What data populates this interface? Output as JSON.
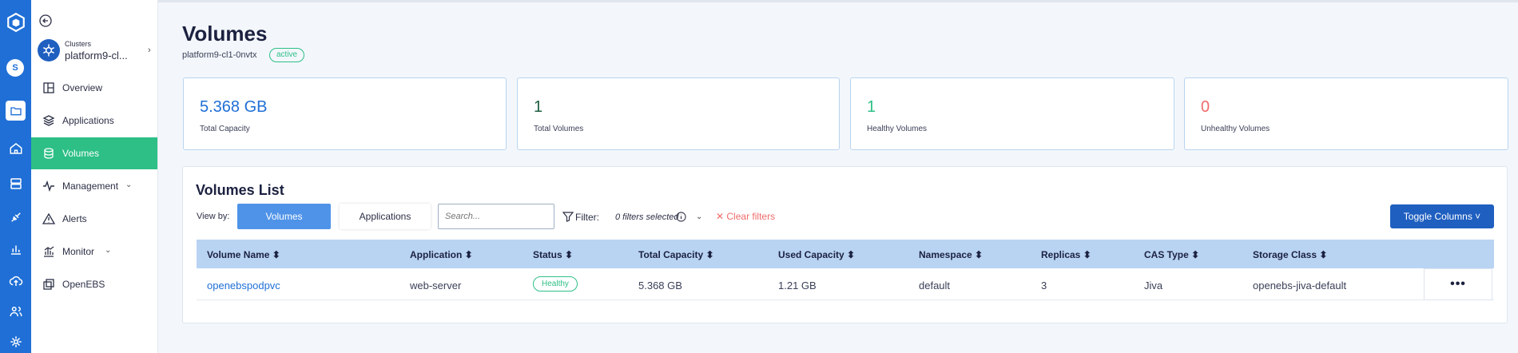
{
  "sidebar": {
    "cluster_caption": "Clusters",
    "cluster_name": "platform9-cl...",
    "items": [
      {
        "label": "Overview"
      },
      {
        "label": "Applications"
      },
      {
        "label": "Volumes"
      },
      {
        "label": "Management"
      },
      {
        "label": "Alerts"
      },
      {
        "label": "Monitor"
      },
      {
        "label": "OpenEBS"
      }
    ]
  },
  "rail": {
    "avatar_letter": "S"
  },
  "header": {
    "title": "Volumes",
    "cluster_id": "platform9-cl1-0nvtx",
    "status": "active"
  },
  "stats": [
    {
      "value": "5.368 GB",
      "label": "Total Capacity",
      "color": "#1f6fd6"
    },
    {
      "value": "1",
      "label": "Total Volumes",
      "color": "#1b5e3f"
    },
    {
      "value": "1",
      "label": "Healthy Volumes",
      "color": "#2dbf86"
    },
    {
      "value": "0",
      "label": "Unhealthy Volumes",
      "color": "#ef6b6b"
    }
  ],
  "list": {
    "title": "Volumes List",
    "view_by_label": "View by:",
    "view_volumes": "Volumes",
    "view_applications": "Applications",
    "search_placeholder": "Search...",
    "filter_label": "Filter:",
    "filters_selected": "0 filters selected",
    "clear_filters": "Clear filters",
    "toggle_columns": "Toggle Columns ˅",
    "columns": [
      "Volume Name",
      "Application",
      "Status",
      "Total Capacity",
      "Used Capacity",
      "Namespace",
      "Replicas",
      "CAS Type",
      "Storage Class"
    ],
    "rows": [
      {
        "volume_name": "openebspodpvc",
        "application": "web-server",
        "status": "Healthy",
        "total_capacity": "5.368 GB",
        "used_capacity": "1.21 GB",
        "namespace": "default",
        "replicas": "3",
        "cas_type": "Jiva",
        "storage_class": "openebs-jiva-default"
      }
    ],
    "more_label": "•••"
  }
}
